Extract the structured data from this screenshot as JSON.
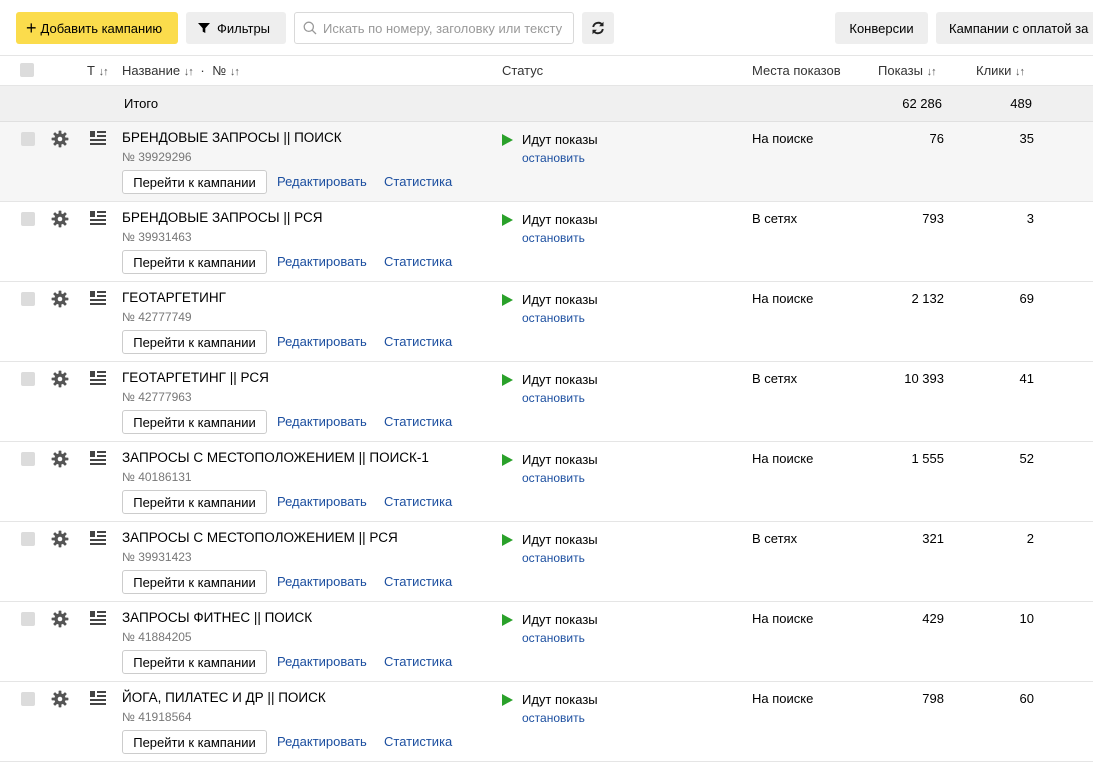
{
  "toolbar": {
    "add_label": "Добавить кампанию",
    "filters_label": "Фильтры",
    "search_placeholder": "Искать по номеру, заголовку или тексту",
    "conversions_label": "Конверсии",
    "paid_label": "Кампании с оплатой за"
  },
  "table": {
    "col_type_short": "Т",
    "col_name": "Название",
    "col_number": "№",
    "col_status": "Статус",
    "col_places": "Места показов",
    "col_impressions": "Показы",
    "col_clicks": "Клики",
    "sort_glyph": "↓↑",
    "dot_separator": "·"
  },
  "total": {
    "label": "Итого",
    "impressions": "62 286",
    "clicks": "489"
  },
  "row_actions": {
    "goto": "Перейти к кампании",
    "edit": "Редактировать",
    "stats": "Статистика",
    "stop": "остановить"
  },
  "rows": [
    {
      "name": "БРЕНДОВЫЕ ЗАПРОСЫ || ПОИСК",
      "id": "№ 39929296",
      "status": "Идут показы",
      "place": "На поиске",
      "impressions": "76",
      "clicks": "35"
    },
    {
      "name": "БРЕНДОВЫЕ ЗАПРОСЫ || РСЯ",
      "id": "№ 39931463",
      "status": "Идут показы",
      "place": "В сетях",
      "impressions": "793",
      "clicks": "3"
    },
    {
      "name": "ГЕОТАРГЕТИНГ",
      "id": "№ 42777749",
      "status": "Идут показы",
      "place": "На поиске",
      "impressions": "2 132",
      "clicks": "69"
    },
    {
      "name": "ГЕОТАРГЕТИНГ || РСЯ",
      "id": "№ 42777963",
      "status": "Идут показы",
      "place": "В сетях",
      "impressions": "10 393",
      "clicks": "41"
    },
    {
      "name": "ЗАПРОСЫ С МЕСТОПОЛОЖЕНИЕМ || ПОИСК-1",
      "id": "№ 40186131",
      "status": "Идут показы",
      "place": "На поиске",
      "impressions": "1 555",
      "clicks": "52"
    },
    {
      "name": "ЗАПРОСЫ С МЕСТОПОЛОЖЕНИЕМ || РСЯ",
      "id": "№ 39931423",
      "status": "Идут показы",
      "place": "В сетях",
      "impressions": "321",
      "clicks": "2"
    },
    {
      "name": "ЗАПРОСЫ ФИТНЕС || ПОИСК",
      "id": "№ 41884205",
      "status": "Идут показы",
      "place": "На поиске",
      "impressions": "429",
      "clicks": "10"
    },
    {
      "name": "ЙОГА, ПИЛАТЕС И ДР || ПОИСК",
      "id": "№ 41918564",
      "status": "Идут показы",
      "place": "На поиске",
      "impressions": "798",
      "clicks": "60"
    }
  ]
}
